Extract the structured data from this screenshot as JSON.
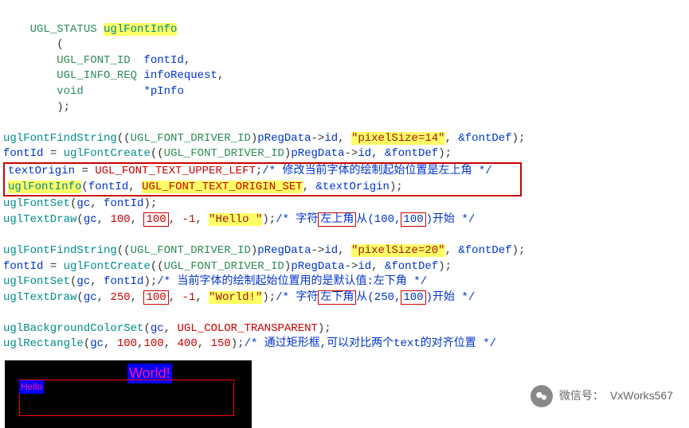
{
  "decl": {
    "ret_type": "UGL_STATUS",
    "fn_name": "uglFontInfo",
    "param1_type": "UGL_FONT_ID",
    "param1_name": "fontId",
    "param2_type": "UGL_INFO_REQ",
    "param2_name": "infoRequest",
    "param3_type": "void",
    "param3_ptr": "*pInfo",
    "close": ");"
  },
  "l1": {
    "fn": "uglFontFindString",
    "cast": "UGL_FONT_DRIVER_ID",
    "arg1a": "pRegData",
    "arg1b": "id",
    "arg2": "\"pixelSize=14\"",
    "arg3": "&fontDef"
  },
  "l2": {
    "lhs": "fontId",
    "fn": "uglFontCreate",
    "cast": "UGL_FONT_DRIVER_ID",
    "arg1a": "pRegData",
    "arg1b": "id",
    "arg3": "&fontDef"
  },
  "l3": {
    "lhs": "textOrigin",
    "rhs": "UGL_FONT_TEXT_UPPER_LEFT",
    "comment": "/* 修改当前字体的绘制起始位置是左上角 */"
  },
  "l4": {
    "fn": "uglFontInfo",
    "a1": "fontId",
    "a2": "UGL_FONT_TEXT_ORIGIN_SET",
    "a3": "&textOrigin"
  },
  "l5": {
    "fn": "uglFontSet",
    "a1": "gc",
    "a2": "fontId"
  },
  "l6": {
    "fn": "uglTextDraw",
    "a1": "gc",
    "a2": "100",
    "a3": "100",
    "a4": "-1",
    "a5": "\"Hello \"",
    "c1": "/* 字符",
    "cbox": "左上角",
    "c2": "从(100,",
    "c2box": "100",
    "c3": ")开始 */"
  },
  "l7": {
    "fn": "uglFontFindString",
    "cast": "UGL_FONT_DRIVER_ID",
    "arg1a": "pRegData",
    "arg1b": "id",
    "arg2": "\"pixelSize=20\"",
    "arg3": "&fontDef"
  },
  "l8": {
    "lhs": "fontId",
    "fn": "uglFontCreate",
    "cast": "UGL_FONT_DRIVER_ID",
    "arg1a": "pRegData",
    "arg1b": "id",
    "arg3": "&fontDef"
  },
  "l9": {
    "fn": "uglFontSet",
    "a1": "gc",
    "a2": "fontId",
    "comment": "/* 当前字体的绘制起始位置用的是默认值:左下角 */"
  },
  "l10": {
    "fn": "uglTextDraw",
    "a1": "gc",
    "a2": "250",
    "a3": "100",
    "a4": "-1",
    "a5": "\"World!\"",
    "c1": "/* 字符",
    "cbox": "左下角",
    "c2": "从(250,",
    "c2box": "100",
    "c3": ")开始 */"
  },
  "l11": {
    "fn": "uglBackgroundColorSet",
    "a1": "gc",
    "a2": "UGL_COLOR_TRANSPARENT"
  },
  "l12": {
    "fn": "uglRectangle",
    "a1": "gc",
    "a2": "100",
    "a3": "100",
    "a4": "400",
    "a5": "150",
    "comment": "/* 通过矩形框,可以对比两个text的对齐位置 */"
  },
  "render": {
    "hello": "Hello",
    "world": "World!"
  },
  "footer": {
    "label": "微信号：",
    "value": "VxWorks567"
  }
}
